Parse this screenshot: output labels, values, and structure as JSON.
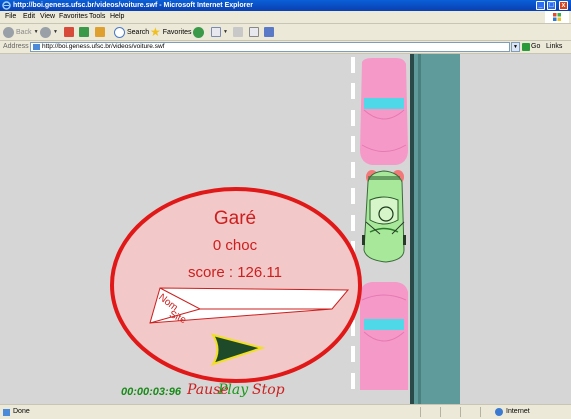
{
  "window": {
    "title": "http://boi.geness.ufsc.br/videos/voiture.swf - Microsoft Internet Explorer",
    "controls": [
      "_",
      "□",
      "x"
    ]
  },
  "menu": {
    "items": [
      "File",
      "Edit",
      "View",
      "Favorites",
      "Tools",
      "Help"
    ]
  },
  "toolbar": {
    "back_label": "Back",
    "search_label": "Search",
    "favorites_label": "Favorites"
  },
  "address": {
    "label": "Address",
    "url": "http://boi.geness.ufsc.br/videos/voiture.swf",
    "go_label": "Go",
    "links_label": "Links"
  },
  "game": {
    "status": "Garé",
    "chocs": "0 choc",
    "score": "score : 126.11",
    "name_label": "Nom",
    "site_label": "Site",
    "timer": "00:00:03:96",
    "pause_label": "Pause",
    "play_label": "Play",
    "stop_label": "Stop"
  },
  "status": {
    "text": "Done",
    "zone": "Internet"
  },
  "colors": {
    "oval_fill": "#f3c8c8",
    "oval_stroke": "#e01818",
    "text_red": "#cc1f1f",
    "car_pink": "#f59ac8",
    "car_window": "#4ed8e8",
    "player_car": "#a8e89a",
    "arrow_fill": "#1f4a2a",
    "arrow_stroke": "#f0e020",
    "sidewalk": "#5f9b9b",
    "timer_green": "#1a8a1a"
  }
}
